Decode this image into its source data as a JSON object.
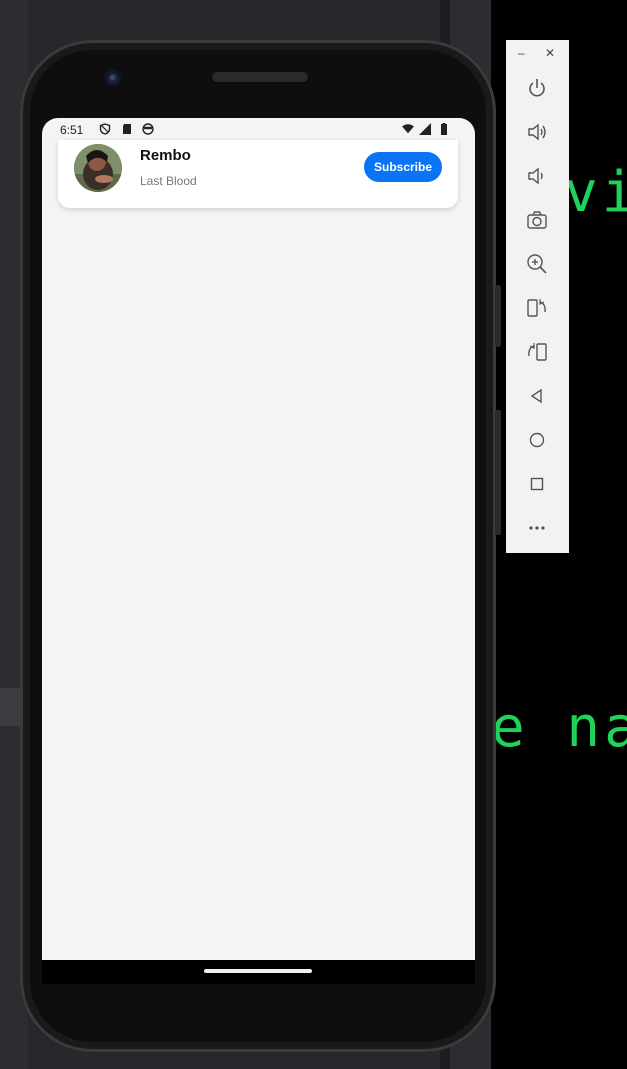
{
  "status_bar": {
    "time": "6:51"
  },
  "card": {
    "title": "Rembo",
    "subtitle": "Last Blood",
    "subscribe_label": "Subscribe"
  },
  "terminal": {
    "line1": "vi",
    "line2": "e na"
  },
  "emulator_toolbar": {
    "minimize_label": "–",
    "close_label": "✕",
    "buttons": [
      "power-icon",
      "volume-up-icon",
      "volume-down-icon",
      "camera-icon",
      "zoom-in-icon",
      "rotate-left-icon",
      "rotate-right-icon",
      "back-icon",
      "home-icon",
      "overview-icon",
      "more-icon"
    ]
  },
  "colors": {
    "accent": "#0a74f5",
    "terminal_text": "#1fd25a",
    "screen_bg": "#f4f4f4"
  }
}
